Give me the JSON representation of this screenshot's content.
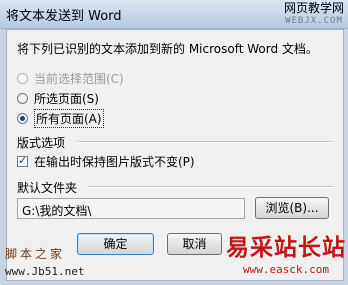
{
  "dialog": {
    "title": "将文本发送到 Word",
    "description": "将下列已识别的文本添加到新的 Microsoft Word 文档。",
    "scope_options": [
      {
        "label": "当前选择范围(C)",
        "enabled": false,
        "checked": false
      },
      {
        "label": "所选页面(S)",
        "enabled": true,
        "checked": false
      },
      {
        "label": "所有页面(A)",
        "enabled": true,
        "checked": true
      }
    ],
    "layout_section": {
      "label": "版式选项",
      "keep_layout_label": "在输出时保持图片版式不变(P)",
      "keep_layout_checked": true
    },
    "folder_section": {
      "label": "默认文件夹",
      "path_value": "G:\\我的文档\\",
      "browse_label": "浏览(B)..."
    },
    "ok_label": "确定",
    "cancel_label": "取消"
  },
  "watermarks": {
    "top_right_line1": "网页教学网",
    "top_right_line2": "WEBJX.COM",
    "bottom_left_line1": "脚本之家",
    "bottom_left_line2": "www.Jb51.net",
    "bottom_right_line1": "易采站长站",
    "bottom_right_line2": "www.easck.com"
  }
}
